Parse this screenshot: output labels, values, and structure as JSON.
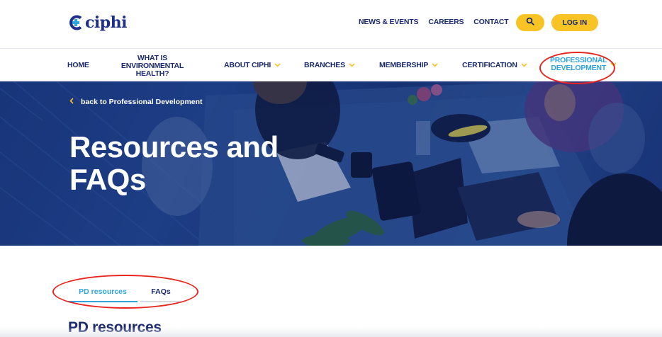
{
  "logo": {
    "text": "ciphi"
  },
  "utility_nav": {
    "items": [
      "NEWS & EVENTS",
      "CAREERS",
      "CONTACT"
    ],
    "search_icon": "search-icon",
    "login_label": "LOG IN"
  },
  "main_nav": {
    "home": "HOME",
    "what_is_line1": "WHAT IS",
    "what_is_line2": "ENVIRONMENTAL",
    "what_is_line3": "HEALTH?",
    "about": "ABOUT CIPHI",
    "branches": "BRANCHES",
    "membership": "MEMBERSHIP",
    "certification": "CERTIFICATION",
    "pro_line1": "PROFESSIONAL",
    "pro_line2": "DEVELOPMENT"
  },
  "hero": {
    "back_label": "back to Professional Development",
    "title_line1": "Resources and",
    "title_line2": "FAQs"
  },
  "tabs": [
    {
      "label": "PD resources",
      "active": true
    },
    {
      "label": "FAQs",
      "active": false
    }
  ],
  "section": {
    "title": "PD resources"
  },
  "colors": {
    "brand_navy": "#1a2a6c",
    "accent_blue": "#2fa4de",
    "accent_yellow": "#f7c325",
    "annotation_red": "#e8251f"
  }
}
